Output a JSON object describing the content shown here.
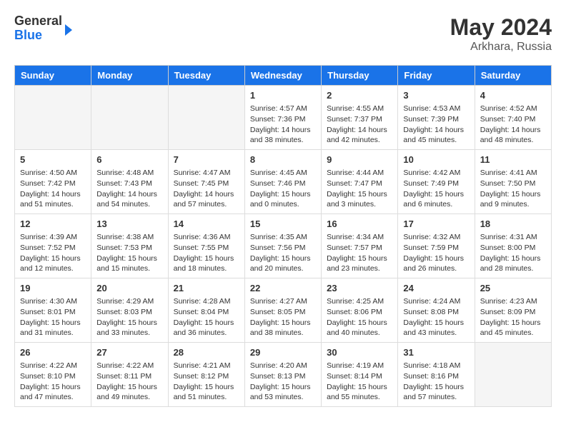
{
  "header": {
    "logo_general": "General",
    "logo_blue": "Blue",
    "month_year": "May 2024",
    "location": "Arkhara, Russia"
  },
  "weekdays": [
    "Sunday",
    "Monday",
    "Tuesday",
    "Wednesday",
    "Thursday",
    "Friday",
    "Saturday"
  ],
  "weeks": [
    [
      {
        "day": "",
        "info": ""
      },
      {
        "day": "",
        "info": ""
      },
      {
        "day": "",
        "info": ""
      },
      {
        "day": "1",
        "info": "Sunrise: 4:57 AM\nSunset: 7:36 PM\nDaylight: 14 hours\nand 38 minutes."
      },
      {
        "day": "2",
        "info": "Sunrise: 4:55 AM\nSunset: 7:37 PM\nDaylight: 14 hours\nand 42 minutes."
      },
      {
        "day": "3",
        "info": "Sunrise: 4:53 AM\nSunset: 7:39 PM\nDaylight: 14 hours\nand 45 minutes."
      },
      {
        "day": "4",
        "info": "Sunrise: 4:52 AM\nSunset: 7:40 PM\nDaylight: 14 hours\nand 48 minutes."
      }
    ],
    [
      {
        "day": "5",
        "info": "Sunrise: 4:50 AM\nSunset: 7:42 PM\nDaylight: 14 hours\nand 51 minutes."
      },
      {
        "day": "6",
        "info": "Sunrise: 4:48 AM\nSunset: 7:43 PM\nDaylight: 14 hours\nand 54 minutes."
      },
      {
        "day": "7",
        "info": "Sunrise: 4:47 AM\nSunset: 7:45 PM\nDaylight: 14 hours\nand 57 minutes."
      },
      {
        "day": "8",
        "info": "Sunrise: 4:45 AM\nSunset: 7:46 PM\nDaylight: 15 hours\nand 0 minutes."
      },
      {
        "day": "9",
        "info": "Sunrise: 4:44 AM\nSunset: 7:47 PM\nDaylight: 15 hours\nand 3 minutes."
      },
      {
        "day": "10",
        "info": "Sunrise: 4:42 AM\nSunset: 7:49 PM\nDaylight: 15 hours\nand 6 minutes."
      },
      {
        "day": "11",
        "info": "Sunrise: 4:41 AM\nSunset: 7:50 PM\nDaylight: 15 hours\nand 9 minutes."
      }
    ],
    [
      {
        "day": "12",
        "info": "Sunrise: 4:39 AM\nSunset: 7:52 PM\nDaylight: 15 hours\nand 12 minutes."
      },
      {
        "day": "13",
        "info": "Sunrise: 4:38 AM\nSunset: 7:53 PM\nDaylight: 15 hours\nand 15 minutes."
      },
      {
        "day": "14",
        "info": "Sunrise: 4:36 AM\nSunset: 7:55 PM\nDaylight: 15 hours\nand 18 minutes."
      },
      {
        "day": "15",
        "info": "Sunrise: 4:35 AM\nSunset: 7:56 PM\nDaylight: 15 hours\nand 20 minutes."
      },
      {
        "day": "16",
        "info": "Sunrise: 4:34 AM\nSunset: 7:57 PM\nDaylight: 15 hours\nand 23 minutes."
      },
      {
        "day": "17",
        "info": "Sunrise: 4:32 AM\nSunset: 7:59 PM\nDaylight: 15 hours\nand 26 minutes."
      },
      {
        "day": "18",
        "info": "Sunrise: 4:31 AM\nSunset: 8:00 PM\nDaylight: 15 hours\nand 28 minutes."
      }
    ],
    [
      {
        "day": "19",
        "info": "Sunrise: 4:30 AM\nSunset: 8:01 PM\nDaylight: 15 hours\nand 31 minutes."
      },
      {
        "day": "20",
        "info": "Sunrise: 4:29 AM\nSunset: 8:03 PM\nDaylight: 15 hours\nand 33 minutes."
      },
      {
        "day": "21",
        "info": "Sunrise: 4:28 AM\nSunset: 8:04 PM\nDaylight: 15 hours\nand 36 minutes."
      },
      {
        "day": "22",
        "info": "Sunrise: 4:27 AM\nSunset: 8:05 PM\nDaylight: 15 hours\nand 38 minutes."
      },
      {
        "day": "23",
        "info": "Sunrise: 4:25 AM\nSunset: 8:06 PM\nDaylight: 15 hours\nand 40 minutes."
      },
      {
        "day": "24",
        "info": "Sunrise: 4:24 AM\nSunset: 8:08 PM\nDaylight: 15 hours\nand 43 minutes."
      },
      {
        "day": "25",
        "info": "Sunrise: 4:23 AM\nSunset: 8:09 PM\nDaylight: 15 hours\nand 45 minutes."
      }
    ],
    [
      {
        "day": "26",
        "info": "Sunrise: 4:22 AM\nSunset: 8:10 PM\nDaylight: 15 hours\nand 47 minutes."
      },
      {
        "day": "27",
        "info": "Sunrise: 4:22 AM\nSunset: 8:11 PM\nDaylight: 15 hours\nand 49 minutes."
      },
      {
        "day": "28",
        "info": "Sunrise: 4:21 AM\nSunset: 8:12 PM\nDaylight: 15 hours\nand 51 minutes."
      },
      {
        "day": "29",
        "info": "Sunrise: 4:20 AM\nSunset: 8:13 PM\nDaylight: 15 hours\nand 53 minutes."
      },
      {
        "day": "30",
        "info": "Sunrise: 4:19 AM\nSunset: 8:14 PM\nDaylight: 15 hours\nand 55 minutes."
      },
      {
        "day": "31",
        "info": "Sunrise: 4:18 AM\nSunset: 8:16 PM\nDaylight: 15 hours\nand 57 minutes."
      },
      {
        "day": "",
        "info": ""
      }
    ]
  ]
}
